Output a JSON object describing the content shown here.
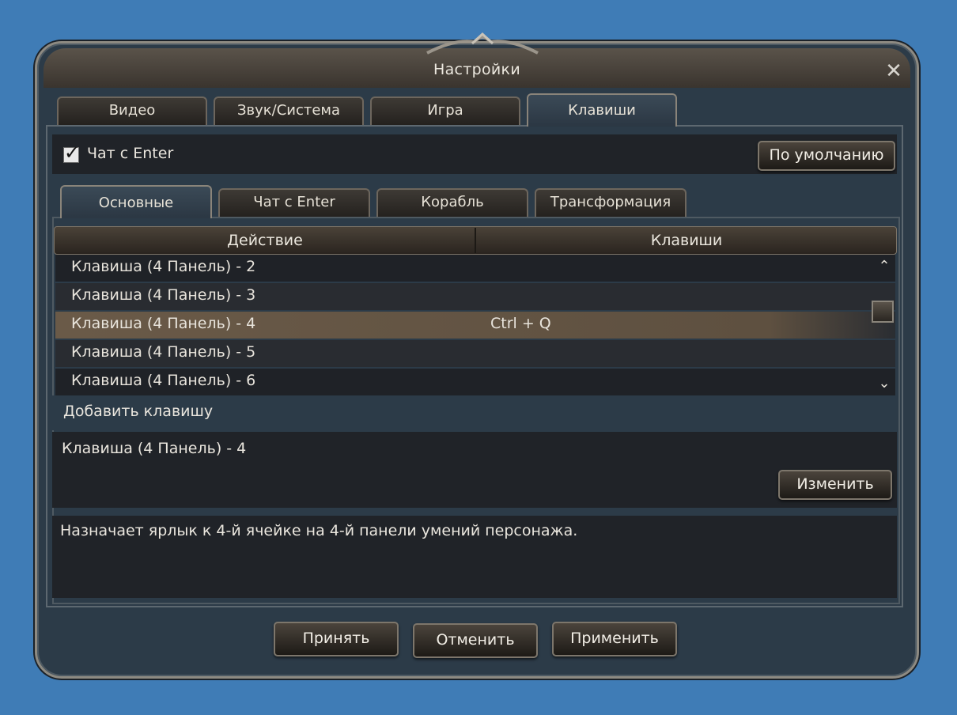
{
  "window": {
    "title": "Настройки"
  },
  "tabs": [
    "Видео",
    "Звук/Система",
    "Игра",
    "Клавиши"
  ],
  "active_tab": "Клавиши",
  "chat_enter": {
    "label": "Чат с Enter",
    "checked": true
  },
  "default_button": "По умолчанию",
  "subtabs": [
    "Основные",
    "Чат с Enter",
    "Корабль",
    "Трансформация"
  ],
  "active_subtab": "Основные",
  "table": {
    "columns": [
      "Действие",
      "Клавиши"
    ],
    "rows": [
      {
        "action": "Клавиша (4 Панель) - 2",
        "keys": ""
      },
      {
        "action": "Клавиша (4 Панель) - 3",
        "keys": ""
      },
      {
        "action": "Клавиша (4 Панель) - 4",
        "keys": "Ctrl + Q"
      },
      {
        "action": "Клавиша (4 Панель) - 5",
        "keys": ""
      },
      {
        "action": "Клавиша (4 Панель) - 6",
        "keys": ""
      }
    ],
    "selected_row": 2
  },
  "add_key_label": "Добавить клавишу",
  "selected_action": "Клавиша (4 Панель) - 4",
  "change_button": "Изменить",
  "description": "Назначает ярлык к 4-й ячейке на 4-й панели умений персонажа.",
  "footer": {
    "accept": "Принять",
    "cancel": "Отменить",
    "apply": "Применить"
  },
  "colors": {
    "background": "#3f7cb6",
    "window_bg": "#2c3b48",
    "selected_row": "#6a5a48"
  }
}
